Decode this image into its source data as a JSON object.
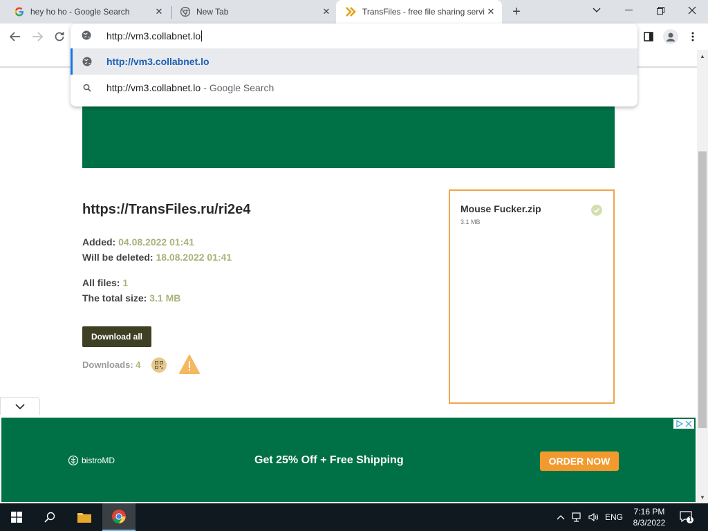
{
  "browser": {
    "tabs": [
      {
        "title": "hey ho ho - Google Search",
        "icon": "google-icon",
        "active": false
      },
      {
        "title": "New Tab",
        "icon": "chrome-icon",
        "active": false
      },
      {
        "title": "TransFiles - free file sharing servi",
        "icon": "transfiles-icon",
        "active": true
      }
    ],
    "omnibox": {
      "value": "http://vm3.collabnet.lo",
      "suggestions": [
        {
          "text": "http://vm3.collabnet.lo",
          "type": "url",
          "selected": true
        },
        {
          "text": "http://vm3.collabnet.lo",
          "suffix": "Google Search",
          "type": "search",
          "selected": false
        }
      ]
    }
  },
  "page": {
    "link": "https://TransFiles.ru/ri2e4",
    "added_label": "Added:",
    "added_value": "04.08.2022 01:41",
    "deleted_label": "Will be deleted:",
    "deleted_value": "18.08.2022 01:41",
    "all_files_label": "All files:",
    "all_files_value": "1",
    "total_size_label": "The total size:",
    "total_size_value": "3.1 MB",
    "download_all": "Download all",
    "downloads_label": "Downloads:",
    "downloads_value": "4",
    "file": {
      "name": "Mouse Fucker.zip",
      "size": "3.1 MB"
    }
  },
  "ad": {
    "brand": "bistroMD",
    "headline": "Get 25% Off + Free Shipping",
    "cta": "ORDER NOW"
  },
  "taskbar": {
    "language": "ENG",
    "time": "7:16 PM",
    "date": "8/3/2022",
    "notifications": "1"
  },
  "colors": {
    "brand_green": "#007146",
    "accent_orange": "#f29a2e",
    "value_olive": "#a8b37a",
    "button_dark": "#3f3f24"
  }
}
